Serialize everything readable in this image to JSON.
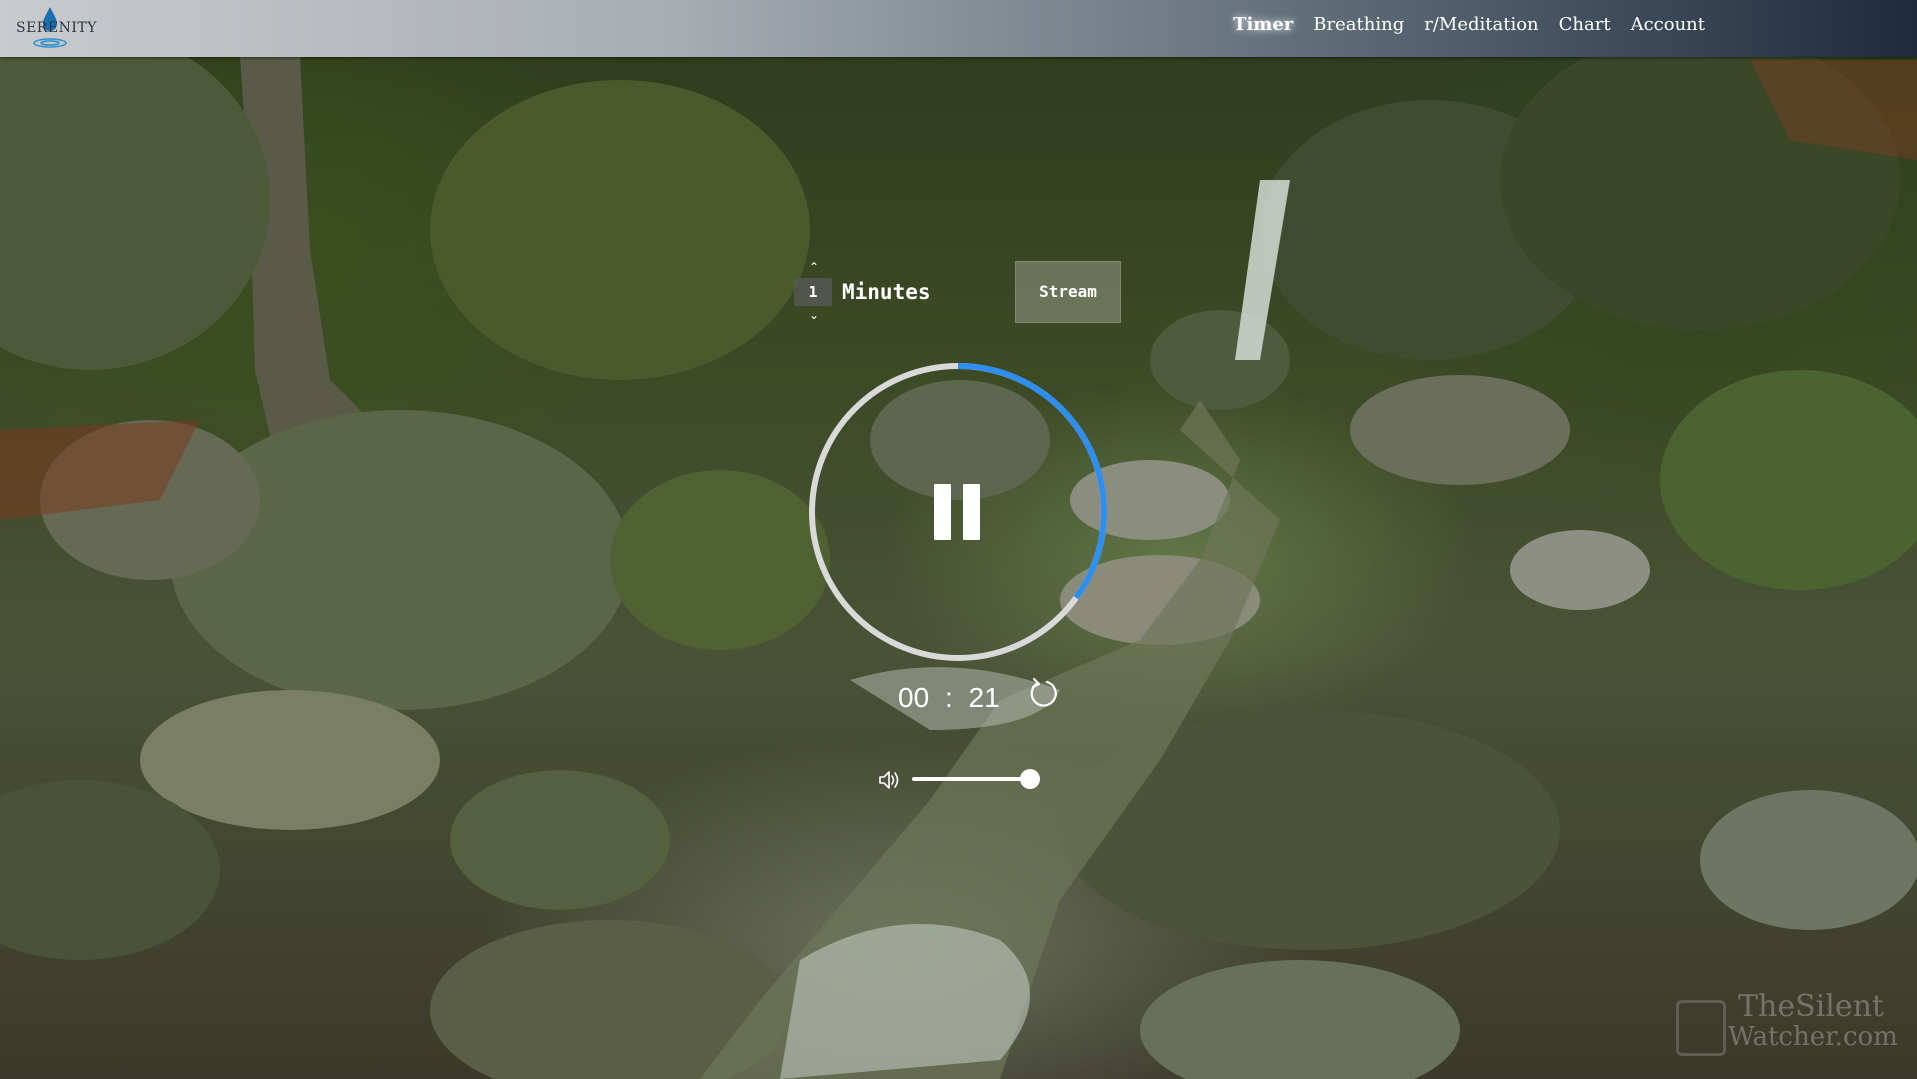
{
  "app": {
    "logo_text": "SERENITY"
  },
  "nav": {
    "items": [
      {
        "label": "Timer",
        "active": true
      },
      {
        "label": "Breathing",
        "active": false
      },
      {
        "label": "r/Meditation",
        "active": false
      },
      {
        "label": "Chart",
        "active": false
      },
      {
        "label": "Account",
        "active": false
      }
    ]
  },
  "timer": {
    "minutes_value": "1",
    "minutes_label": "Minutes",
    "stream_label": "Stream",
    "time_minutes": "00",
    "time_separator": ":",
    "time_seconds": "21",
    "progress_fraction": 0.35,
    "state": "playing"
  },
  "volume": {
    "level": 1.0
  },
  "background": {
    "watermark_line1": "TheSilent",
    "watermark_line2": "Watcher.com"
  },
  "colors": {
    "ring_track": "#d9d9d9",
    "ring_progress": "#2f8ff0",
    "text": "#ffffff"
  }
}
